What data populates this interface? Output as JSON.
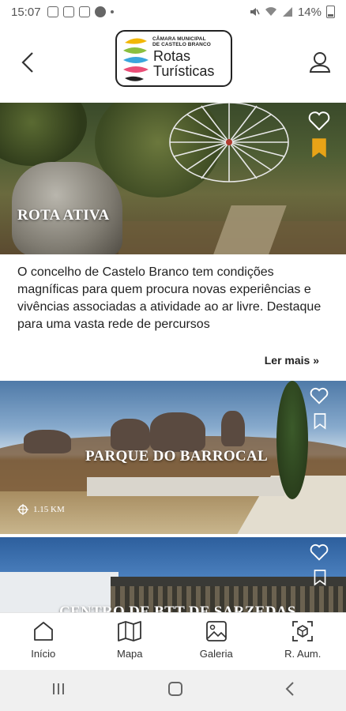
{
  "status_bar": {
    "time": "15:07",
    "battery": "14%"
  },
  "header": {
    "logo_line1": "CÂMARA MUNICIPAL",
    "logo_line2": "DE CASTELO BRANCO",
    "logo_title_line1": "Rotas",
    "logo_title_line2": "Turísticas",
    "back_icon": "chevron-left-icon",
    "user_icon": "user-icon"
  },
  "cards": [
    {
      "title": "ROTA ATIVA",
      "description": "O concelho de Castelo Branco tem condições magníficas para quem procura novas experiências e vivências associadas a atividade ao ar livre. Destaque para uma vasta rede de percursos",
      "read_more": "Ler mais »",
      "favorited": false,
      "bookmarked": true
    },
    {
      "title": "PARQUE DO BARROCAL",
      "distance": "1.15 KM",
      "favorited": false,
      "bookmarked": false
    },
    {
      "title": "CENTRO DE BTT DE SARZEDAS",
      "favorited": false,
      "bookmarked": false
    }
  ],
  "bottom_nav": [
    {
      "label": "Início",
      "icon": "home-icon"
    },
    {
      "label": "Mapa",
      "icon": "map-icon"
    },
    {
      "label": "Galeria",
      "icon": "gallery-icon"
    },
    {
      "label": "R. Aum.",
      "icon": "augmented-reality-icon"
    }
  ],
  "colors": {
    "bookmark_active": "#e8a317",
    "text": "#222222",
    "icon_white": "#ffffff"
  }
}
